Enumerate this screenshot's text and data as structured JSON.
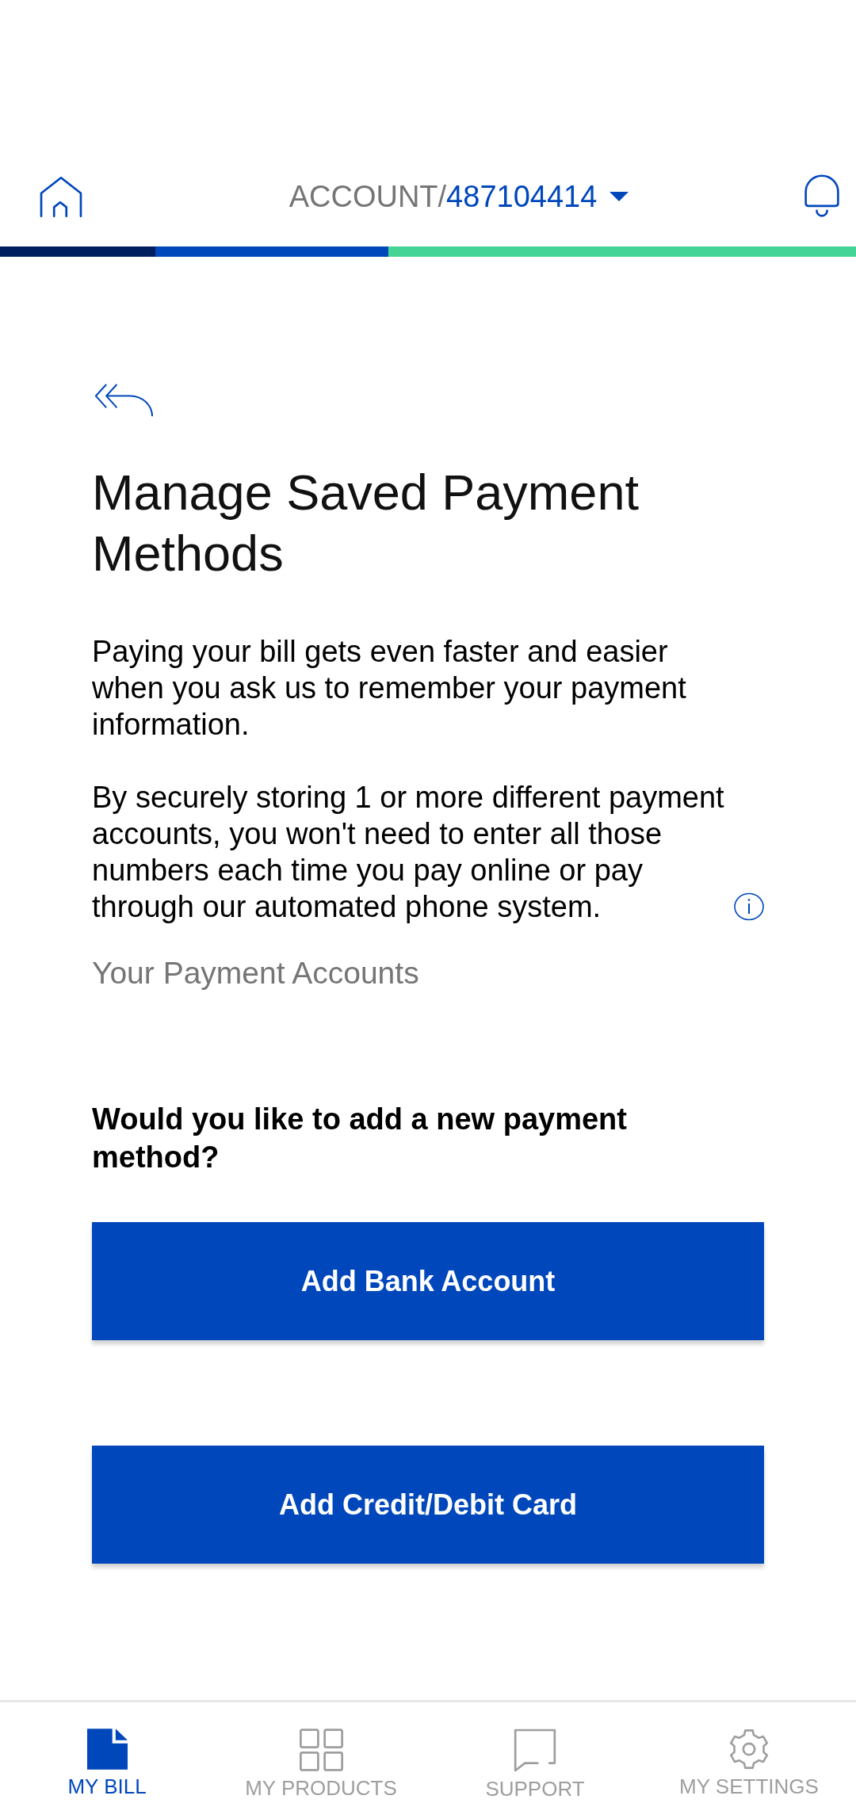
{
  "header": {
    "account_prefix": "ACCOUNT/",
    "account_number": "487104414"
  },
  "page": {
    "title": "Manage Saved Payment Methods",
    "paragraphs": [
      {
        "text": "Paying your bill gets even faster and easier when you ask us to remember your payment information.",
        "info_icon": false
      },
      {
        "text": "By securely storing 1 or more different payment accounts, you won't need to enter all those numbers each time you pay online or pay through our automated phone system.",
        "info_icon": true
      }
    ],
    "section_label": "Your Payment Accounts",
    "question": "Would you like to add a new payment method?",
    "buttons": [
      "Add Bank Account",
      "Add Credit/Debit Card"
    ]
  },
  "bottom_nav": [
    {
      "label": "MY BILL",
      "kind": "bill",
      "selected": true
    },
    {
      "label": "MY PRODUCTS",
      "kind": "products",
      "selected": false
    },
    {
      "label": "SUPPORT",
      "kind": "support",
      "selected": false
    },
    {
      "label": "MY SETTINGS",
      "kind": "settings",
      "selected": false
    }
  ]
}
